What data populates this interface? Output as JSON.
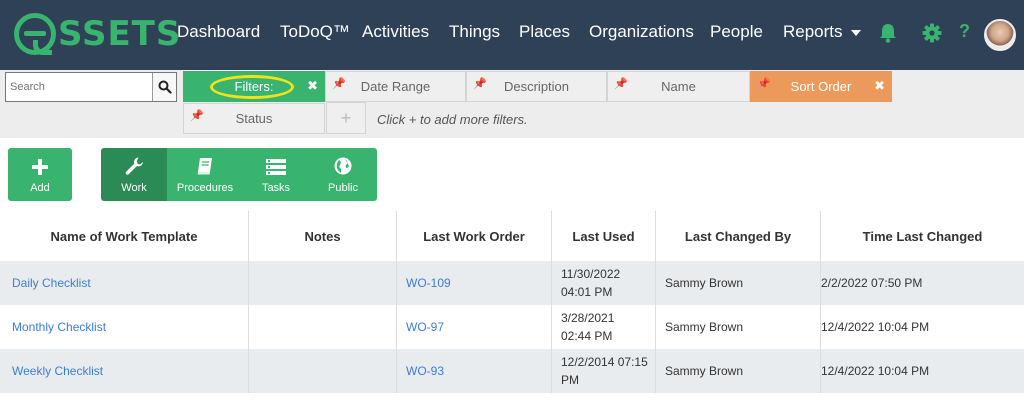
{
  "brand": {
    "logo_text": "SSETS",
    "accent": "#38b46e",
    "nav_bg": "#2f4156"
  },
  "nav": {
    "items": [
      "Dashboard",
      "ToDoQ™",
      "Activities",
      "Things",
      "Places",
      "Organizations",
      "People",
      "Reports"
    ],
    "icons": [
      "bell-icon",
      "gear-icon",
      "help-icon"
    ],
    "help_label": "?"
  },
  "search": {
    "placeholder": "Search",
    "value": ""
  },
  "filters": {
    "chips": [
      "Filters:",
      "Date Range",
      "Description",
      "Name",
      "Sort Order",
      "Status"
    ],
    "add_label": "+",
    "hint": "Click + to add more filters."
  },
  "toolbar": {
    "add_label": "Add",
    "view_buttons": [
      "Work",
      "Procedures",
      "Tasks",
      "Public"
    ],
    "active_view": "Work"
  },
  "table": {
    "columns": [
      "Name of Work Template",
      "Notes",
      "Last Work Order",
      "Last Used",
      "Last Changed By",
      "Time Last Changed"
    ],
    "rows": [
      {
        "name": "Daily Checklist",
        "notes": "",
        "last_work_order": "WO-109",
        "last_used_1": "11/30/2022",
        "last_used_2": "04:01 PM",
        "changed_by": "Sammy Brown",
        "time_changed": "2/2/2022 07:50 PM"
      },
      {
        "name": "Monthly Checklist",
        "notes": "",
        "last_work_order": "WO-97",
        "last_used_1": "3/28/2021",
        "last_used_2": "02:44 PM",
        "changed_by": "Sammy Brown",
        "time_changed": "12/4/2022 10:04 PM"
      },
      {
        "name": "Weekly Checklist",
        "notes": "",
        "last_work_order": "WO-93",
        "last_used_1": "12/2/2014 07:15",
        "last_used_2": "PM",
        "changed_by": "Sammy Brown",
        "time_changed": "12/4/2022 10:04 PM"
      }
    ]
  }
}
